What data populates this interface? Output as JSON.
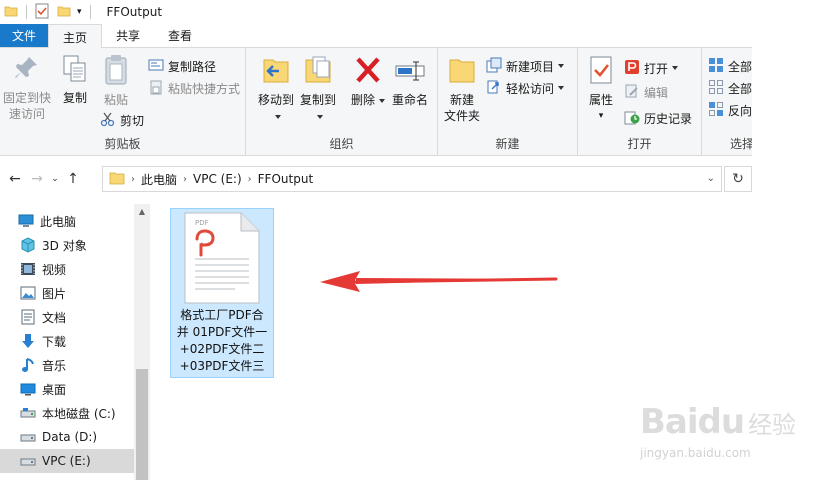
{
  "window": {
    "title": "FFOutput"
  },
  "tabs": {
    "file": "文件",
    "home": "主页",
    "share": "共享",
    "view": "查看"
  },
  "ribbon": {
    "clipboard": {
      "label": "剪贴板",
      "pin_line1": "固定到快",
      "pin_line2": "速访问",
      "copy": "复制",
      "paste": "粘贴",
      "copy_path": "复制路径",
      "paste_shortcut": "粘贴快捷方式",
      "cut": "剪切"
    },
    "organize": {
      "label": "组织",
      "move_to": "移动到",
      "copy_to": "复制到",
      "delete": "删除",
      "rename": "重命名"
    },
    "new": {
      "label": "新建",
      "new_folder_line1": "新建",
      "new_folder_line2": "文件夹",
      "new_item": "新建项目",
      "easy_access": "轻松访问"
    },
    "open": {
      "label": "打开",
      "properties": "属性",
      "open": "打开",
      "edit": "编辑",
      "history": "历史记录"
    },
    "select": {
      "label": "选择",
      "select_all": "全部",
      "select_none": "全部",
      "invert": "反向"
    }
  },
  "address": {
    "crumbs": [
      "此电脑",
      "VPC (E:)",
      "FFOutput"
    ]
  },
  "nav": {
    "items": [
      {
        "label": "此电脑",
        "icon": "computer-icon"
      },
      {
        "label": "3D 对象",
        "icon": "3d-objects-icon"
      },
      {
        "label": "视频",
        "icon": "video-icon"
      },
      {
        "label": "图片",
        "icon": "pictures-icon"
      },
      {
        "label": "文档",
        "icon": "documents-icon"
      },
      {
        "label": "下载",
        "icon": "download-icon"
      },
      {
        "label": "音乐",
        "icon": "music-icon"
      },
      {
        "label": "桌面",
        "icon": "desktop-icon"
      },
      {
        "label": "本地磁盘 (C:)",
        "icon": "drive-icon"
      },
      {
        "label": "Data (D:)",
        "icon": "drive-icon"
      },
      {
        "label": "VPC (E:)",
        "icon": "drive-icon"
      }
    ]
  },
  "content": {
    "file": {
      "line1": "格式工厂PDF合",
      "line2": "并 01PDF文件一",
      "line3": "+02PDF文件二",
      "line4": "+03PDF文件三",
      "type_tag": "PDF"
    }
  },
  "watermark": {
    "logo_text": "Baidu",
    "text": "经验",
    "url": "jingyan.baidu.com"
  },
  "colors": {
    "file_tab": "#1979ca",
    "selection": "#cce8ff",
    "arrow": "#e53935"
  }
}
